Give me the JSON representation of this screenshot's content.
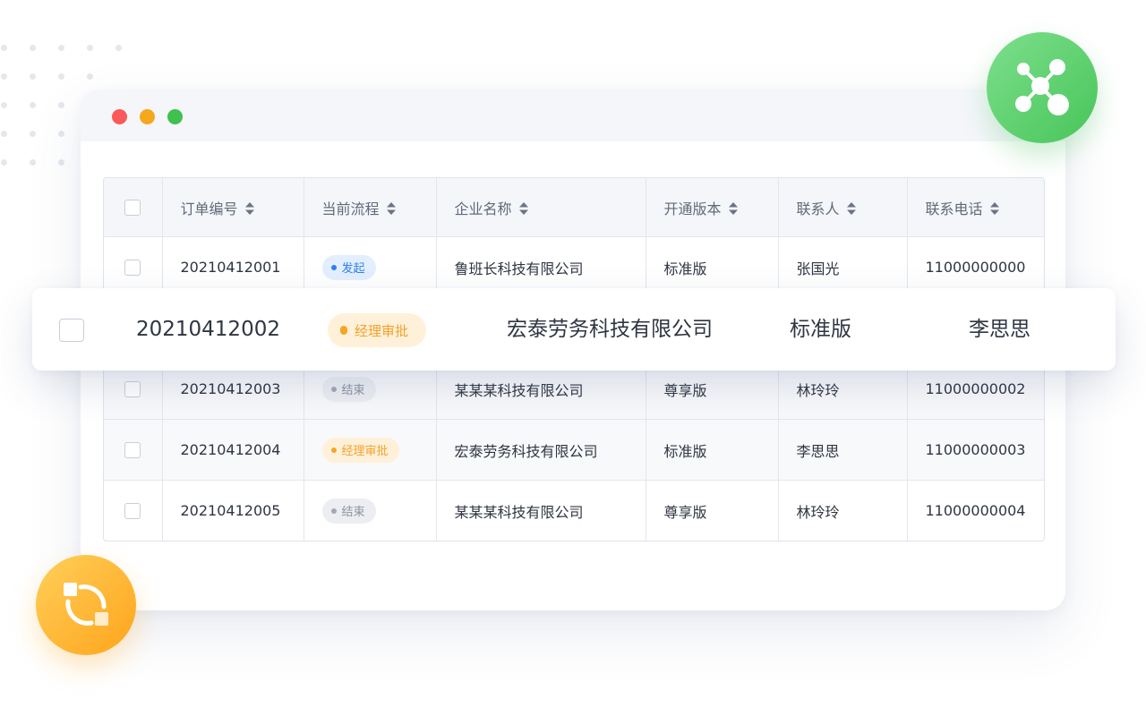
{
  "table": {
    "headers": [
      "订单编号",
      "当前流程",
      "企业名称",
      "开通版本",
      "联系人",
      "联系电话"
    ],
    "rows": [
      {
        "order_no": "20210412001",
        "status": "发起",
        "status_color": "blue",
        "company": "鲁班长科技有限公司",
        "edition": "标准版",
        "contact": "张国光",
        "phone": "11000000000"
      },
      {
        "order_no": "20210412003",
        "status": "结束",
        "status_color": "gray",
        "company": "某某某科技有限公司",
        "edition": "尊享版",
        "contact": "林玲玲",
        "phone": "11000000002"
      },
      {
        "order_no": "20210412004",
        "status": "经理审批",
        "status_color": "orange",
        "company": "宏泰劳务科技有限公司",
        "edition": "标准版",
        "contact": "李思思",
        "phone": "11000000003"
      },
      {
        "order_no": "20210412005",
        "status": "结束",
        "status_color": "gray",
        "company": "某某某科技有限公司",
        "edition": "尊享版",
        "contact": "林玲玲",
        "phone": "11000000004"
      }
    ]
  },
  "highlight_row": {
    "order_no": "20210412002",
    "status": "经理审批",
    "status_color": "orange",
    "company": "宏泰劳务科技有限公司",
    "edition": "标准版",
    "contact": "李思思"
  },
  "icons": {
    "top_right": "network-nodes-icon",
    "bottom_left": "sync-process-icon",
    "sort": "sort-icon"
  },
  "colors": {
    "badge_blue": "#2f80ed",
    "badge_orange": "#f5a623",
    "badge_gray": "#a3a9b4",
    "green_circle": "#48c55a",
    "orange_circle": "#ffa41b",
    "traffic_red": "#fb5a5a",
    "traffic_yellow": "#f7a71b",
    "traffic_green": "#3fc04f"
  }
}
